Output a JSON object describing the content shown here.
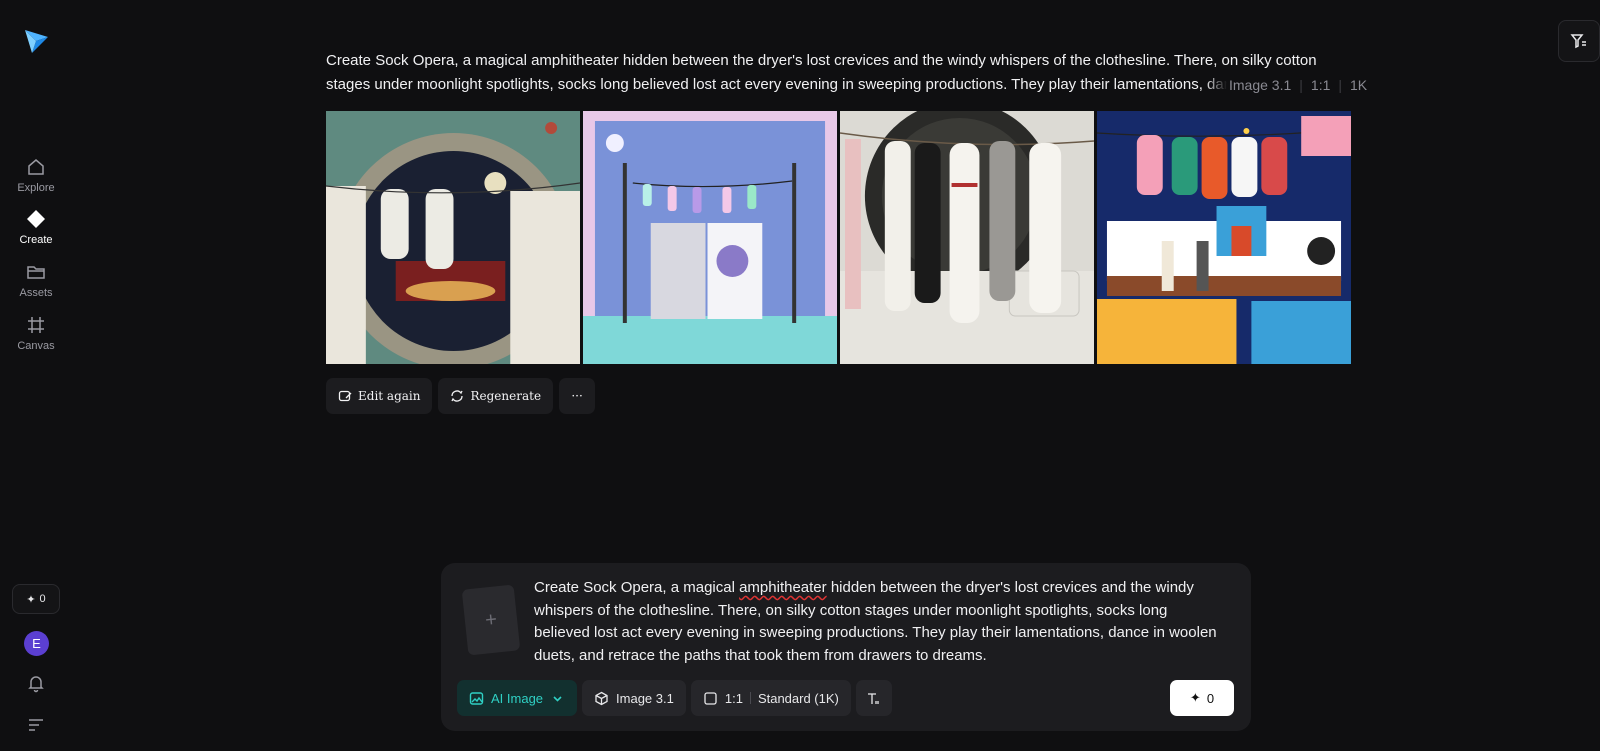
{
  "sidebar": {
    "items": [
      {
        "label": "Explore",
        "icon": "home-icon"
      },
      {
        "label": "Create",
        "icon": "diamond-icon"
      },
      {
        "label": "Assets",
        "icon": "folder-icon"
      },
      {
        "label": "Canvas",
        "icon": "crop-icon"
      }
    ],
    "credits": "0",
    "avatar_initial": "E"
  },
  "header": {
    "prompt": "Create Sock Opera, a magical amphitheater hidden between the dryer's lost crevices and the windy whispers of the clothesline. There, on silky cotton stages under moonlight spotlights, socks long believed lost act every evening in sweeping productions. They play their lamentations, dance in woolen duets, and retrace the paths that took them from drawers to dreams.",
    "model": "Image 3.1",
    "ratio": "1:1",
    "resolution": "1K"
  },
  "images": [
    {
      "alt": "washing machine porthole stage"
    },
    {
      "alt": "pastel laundry stage"
    },
    {
      "alt": "socks on clothesline"
    },
    {
      "alt": "colorful sock theater"
    }
  ],
  "actions": {
    "edit_again": "Edit again",
    "regenerate": "Regenerate",
    "more": "···"
  },
  "composer": {
    "upload_symbol": "+",
    "text_before": "Create Sock Opera, a magical ",
    "text_misspelled": "amphitheater",
    "text_after": " hidden between the dryer's lost crevices and the windy whispers of the clothesline. There, on silky cotton stages under moonlight spotlights, socks long believed lost act every evening in sweeping productions. They play their lamentations, dance in woolen duets, and retrace the paths that took them from drawers to dreams.",
    "mode": "AI Image",
    "model": "Image 3.1",
    "ratio": "1:1",
    "quality": "Standard (1K)",
    "generate_cost": "0"
  },
  "colors": {
    "background": "#0f0f11",
    "panel": "#1c1c1f",
    "accent": "#2fd0c4",
    "avatar": "#5b3fd1"
  }
}
